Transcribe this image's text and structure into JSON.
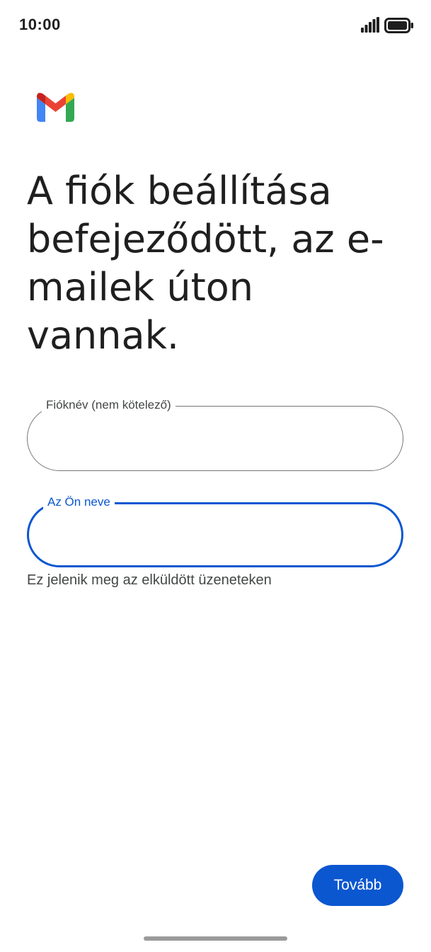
{
  "status_bar": {
    "time": "10:00",
    "icons": [
      "signal-icon",
      "battery-icon"
    ]
  },
  "app": {
    "logo": "gmail-logo",
    "brand_colors": {
      "blue": "#4285F4",
      "red": "#EA4335",
      "yellow": "#FBBC04",
      "green": "#34A853",
      "dark_red": "#C5221F"
    }
  },
  "headline": "A fiók beállítása befejeződött, az e-mailek úton vannak.",
  "form": {
    "account_name": {
      "label": "Fióknév (nem kötelező)",
      "value": ""
    },
    "your_name": {
      "label": "Az Ön neve",
      "value": "",
      "helper": "Ez jelenik meg az elküldött üzeneteken"
    }
  },
  "actions": {
    "next_label": "Tovább"
  },
  "colors": {
    "accent": "#0b57d0",
    "outline": "#747775",
    "text": "#1f1f1f",
    "secondary_text": "#444746"
  }
}
